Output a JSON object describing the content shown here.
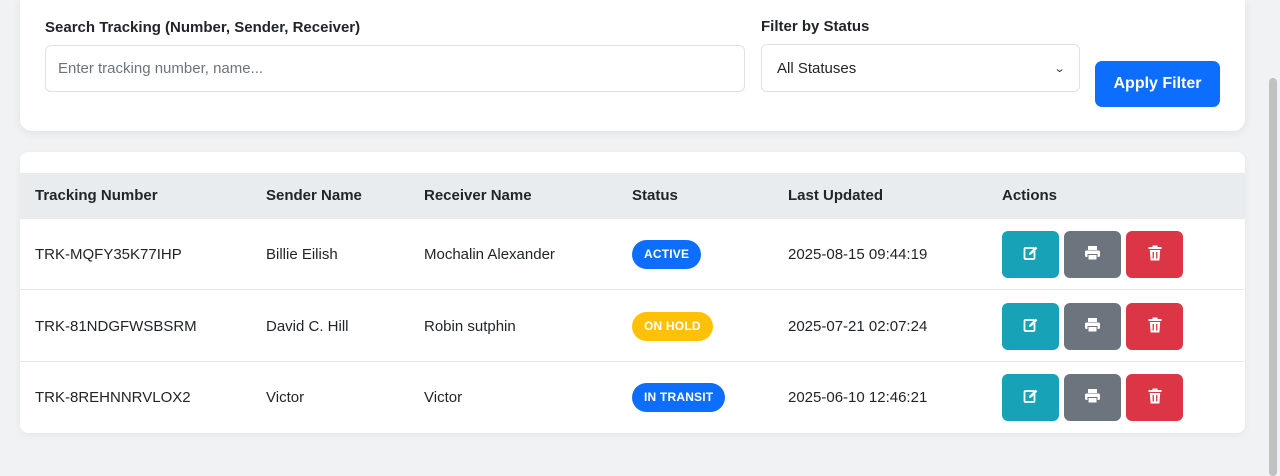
{
  "filters": {
    "search_label": "Search Tracking (Number, Sender, Receiver)",
    "search_placeholder": "Enter tracking number, name...",
    "search_value": "",
    "status_label": "Filter by Status",
    "status_selected": "All Statuses",
    "apply_label": "Apply Filter"
  },
  "table": {
    "headers": [
      "Tracking Number",
      "Sender Name",
      "Receiver Name",
      "Status",
      "Last Updated",
      "Actions"
    ],
    "rows": [
      {
        "tracking": "TRK-MQFY35K77IHP",
        "sender": "Billie Eilish",
        "receiver": "Mochalin Alexander",
        "status": "ACTIVE",
        "status_color": "#0d6efd",
        "status_text_color": "#ffffff",
        "updated": "2025-08-15 09:44:19"
      },
      {
        "tracking": "TRK-81NDGFWSBSRM",
        "sender": "David C. Hill",
        "receiver": "Robin sutphin",
        "status": "ON HOLD",
        "status_color": "#ffc107",
        "status_text_color": "#ffffff",
        "updated": "2025-07-21 02:07:24"
      },
      {
        "tracking": "TRK-8REHNNRVLOX2",
        "sender": "Victor",
        "receiver": "Victor",
        "status": "IN TRANSIT",
        "status_color": "#0d6efd",
        "status_text_color": "#ffffff",
        "updated": "2025-06-10 12:46:21"
      }
    ],
    "actions": [
      {
        "name": "edit-button",
        "icon": "edit-icon",
        "color": "#17a2b8"
      },
      {
        "name": "print-button",
        "icon": "print-icon",
        "color": "#6c757d"
      },
      {
        "name": "delete-button",
        "icon": "trash-icon",
        "color": "#dc3545"
      }
    ]
  }
}
